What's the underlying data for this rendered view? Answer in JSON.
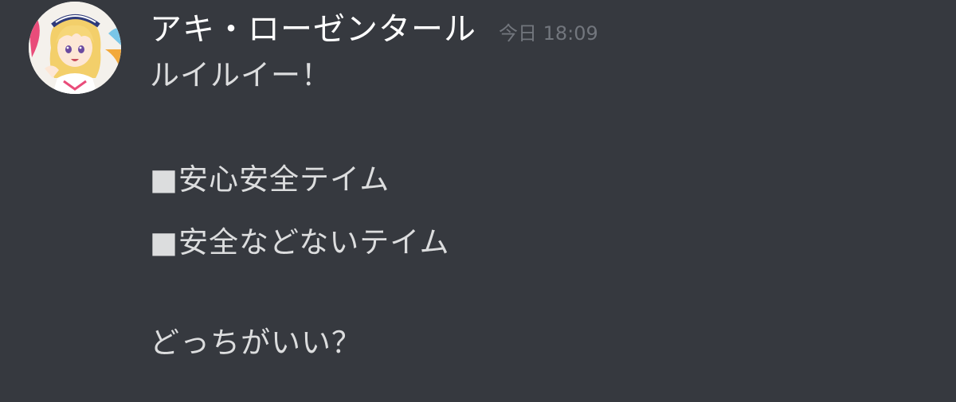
{
  "message": {
    "author": "アキ・ローゼンタール",
    "timestamp": "今日 18:09",
    "avatar_icon": "user-avatar-icon",
    "lines": [
      "ルイルイー！",
      "■安心安全テイム",
      "■安全などないテイム",
      "どっちがいい？"
    ]
  },
  "colors": {
    "background": "#36393f",
    "username": "#ffffff",
    "timestamp": "#72767d",
    "text": "#dcddde"
  }
}
